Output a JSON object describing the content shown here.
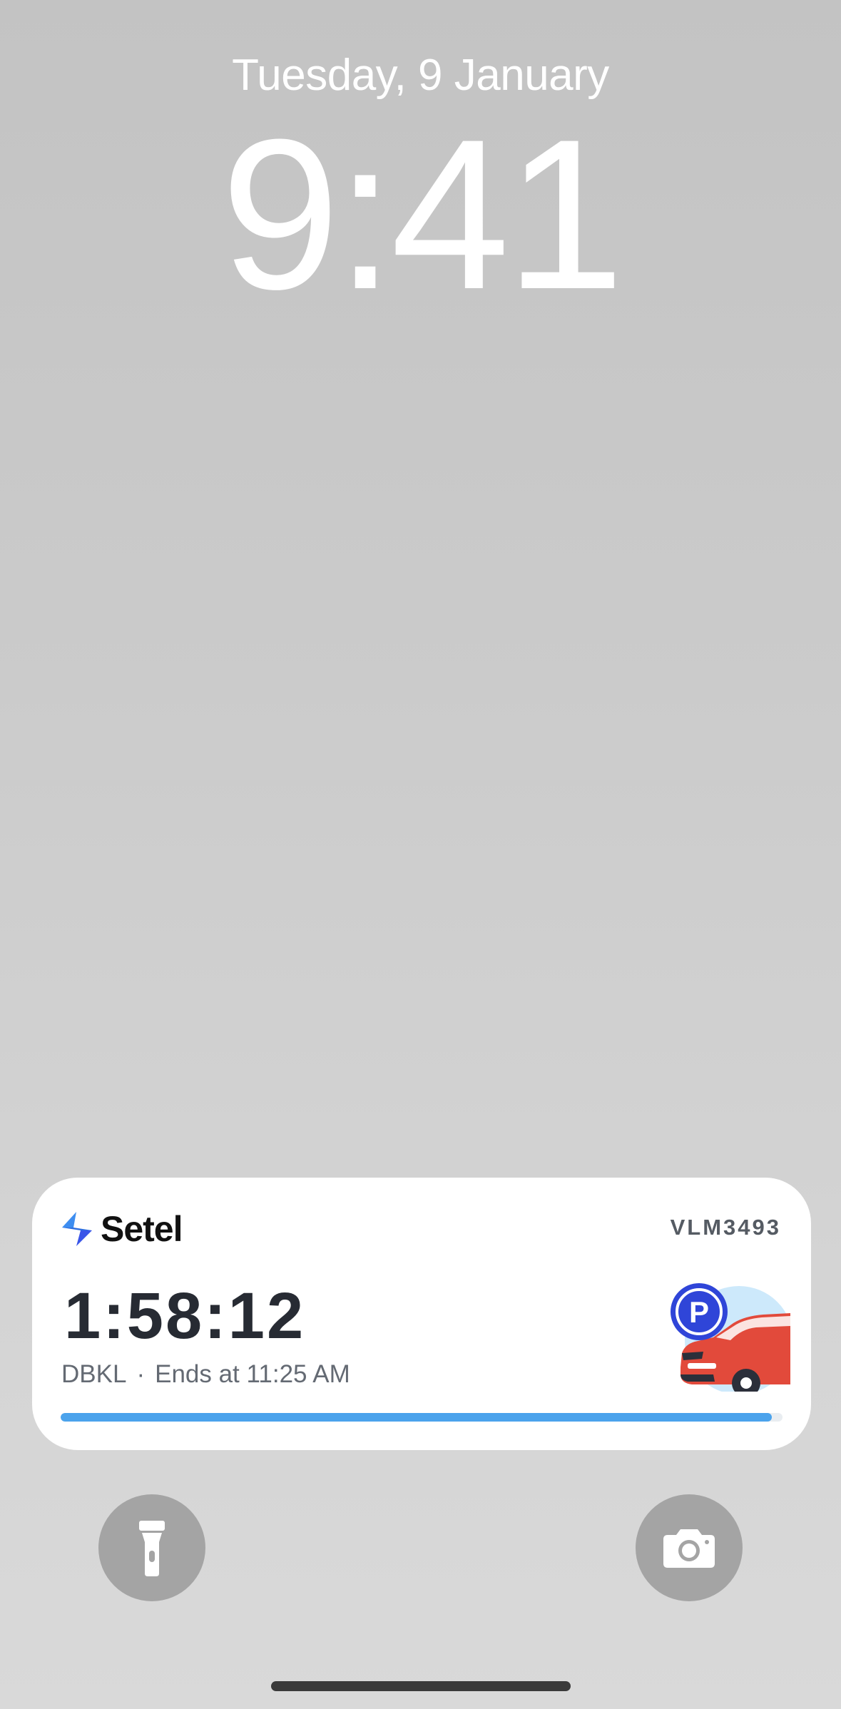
{
  "lockscreen": {
    "date": "Tuesday, 9 January",
    "time": "9:41"
  },
  "live_activity": {
    "app_name": "Setel",
    "plate": "VLM3493",
    "timer": "1:58:12",
    "location": "DBKL",
    "separator": "·",
    "ends_text": "Ends at 11:25 AM",
    "progress_fraction": 0.985,
    "parking_badge_letter": "P",
    "colors": {
      "progress": "#4ba3ec",
      "parking_badge": "#2f45d8",
      "car": "#e24a3b",
      "illustration_bg": "#cde9fb"
    }
  },
  "quick_actions": {
    "left_icon": "flashlight-icon",
    "right_icon": "camera-icon"
  }
}
